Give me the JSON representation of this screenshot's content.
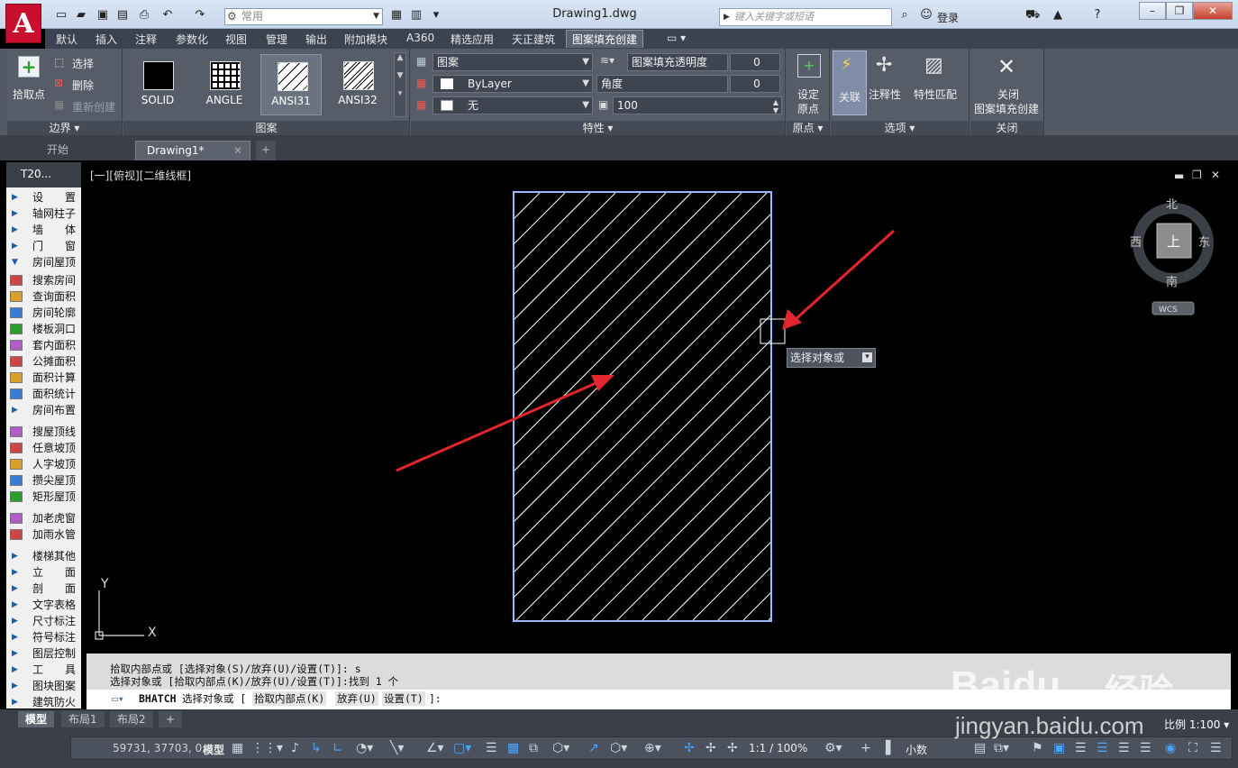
{
  "window": {
    "title": "Drawing1.dwg",
    "workspace": "常用",
    "search_placeholder": "键入关键字或短语",
    "login": "登录"
  },
  "menu_tabs": [
    "默认",
    "插入",
    "注释",
    "参数化",
    "视图",
    "管理",
    "输出",
    "附加模块",
    "A360",
    "精选应用",
    "天正建筑",
    "图案填充创建"
  ],
  "ribbon": {
    "boundary": {
      "pick_point": "拾取点",
      "select": "选择",
      "remove": "删除",
      "recreate": "重新创建",
      "label": "边界 ▾"
    },
    "pattern": {
      "tiles": [
        "SOLID",
        "ANGLE",
        "ANSI31",
        "ANSI32"
      ],
      "label": "图案"
    },
    "properties": {
      "type": "图案",
      "color": "ByLayer",
      "background": "无",
      "transparency_label": "图案填充透明度",
      "transparency_value": "0",
      "angle_label": "角度",
      "angle_value": "0",
      "scale_value": "100",
      "label": "特性 ▾"
    },
    "origin": {
      "set_origin_line1": "设定",
      "set_origin_line2": "原点",
      "label": "原点 ▾"
    },
    "options": {
      "associative": "关联",
      "annotative": "注释性",
      "match_props": "特性匹配",
      "label": "选项 ▾"
    },
    "close": {
      "line1": "关闭",
      "line2": "图案填充创建",
      "label": "关闭"
    }
  },
  "file_tabs": {
    "start": "开始",
    "drawing": "Drawing1*"
  },
  "palette": {
    "title": "T20...",
    "items": [
      {
        "label": "设　　置",
        "kind": "tri"
      },
      {
        "label": "轴网柱子",
        "kind": "tri"
      },
      {
        "label": "墙　　体",
        "kind": "tri"
      },
      {
        "label": "门　　窗",
        "kind": "tri"
      },
      {
        "label": "房间屋顶",
        "kind": "open"
      },
      {
        "label": "搜索房间",
        "kind": "icon"
      },
      {
        "label": "查询面积",
        "kind": "icon"
      },
      {
        "label": "房间轮廓",
        "kind": "icon"
      },
      {
        "label": "楼板洞口",
        "kind": "icon"
      },
      {
        "label": "套内面积",
        "kind": "icon"
      },
      {
        "label": "公摊面积",
        "kind": "icon"
      },
      {
        "label": "面积计算",
        "kind": "icon"
      },
      {
        "label": "面积统计",
        "kind": "icon"
      },
      {
        "label": "房间布置",
        "kind": "tri"
      },
      {
        "label": "搜屋顶线",
        "kind": "icon"
      },
      {
        "label": "任意坡顶",
        "kind": "icon"
      },
      {
        "label": "人字坡顶",
        "kind": "icon"
      },
      {
        "label": "攒尖屋顶",
        "kind": "icon"
      },
      {
        "label": "矩形屋顶",
        "kind": "icon"
      },
      {
        "label": "加老虎窗",
        "kind": "icon"
      },
      {
        "label": "加雨水管",
        "kind": "icon"
      },
      {
        "label": "楼梯其他",
        "kind": "tri"
      },
      {
        "label": "立　　面",
        "kind": "tri"
      },
      {
        "label": "剖　　面",
        "kind": "tri"
      },
      {
        "label": "文字表格",
        "kind": "tri"
      },
      {
        "label": "尺寸标注",
        "kind": "tri"
      },
      {
        "label": "符号标注",
        "kind": "tri"
      },
      {
        "label": "图层控制",
        "kind": "tri"
      },
      {
        "label": "工　　具",
        "kind": "tri"
      },
      {
        "label": "图块图案",
        "kind": "tri"
      },
      {
        "label": "建筑防火",
        "kind": "tri"
      }
    ]
  },
  "viewport": {
    "label": "[一][俯视][二维线框]",
    "tooltip": "选择对象或",
    "compass": {
      "north": "北",
      "south": "南",
      "east": "东",
      "west": "西",
      "top": "上",
      "wcs": "WCS"
    },
    "ucs_x": "X",
    "ucs_y": "Y"
  },
  "command": {
    "history": [
      "拾取内部点或 [选择对象(S)/放弃(U)/设置(T)]: s",
      "选择对象或 [拾取内部点(K)/放弃(U)/设置(T)]:找到 1 个"
    ],
    "prompt_cmd": "BHATCH",
    "prompt_text": "选择对象或 [",
    "opt1": "拾取内部点(K)",
    "opt2": "放弃(U)",
    "opt3": "设置(T)",
    "prompt_end": "]:"
  },
  "layout_tabs": [
    "模型",
    "布局1",
    "布局2"
  ],
  "status": {
    "coords": "59731, 37703, 0",
    "model": "模型",
    "scale": "1:1 / 100%",
    "units": "小数",
    "ratio": "比例 1:100"
  },
  "watermark": {
    "brand": "Baidu",
    "cn": "经验",
    "url": "jingyan.baidu.com"
  },
  "colors": {
    "accent_red": "#e2262b",
    "hatch_boundary": "#9ab8ff",
    "ribbon_bg": "#535a66"
  }
}
